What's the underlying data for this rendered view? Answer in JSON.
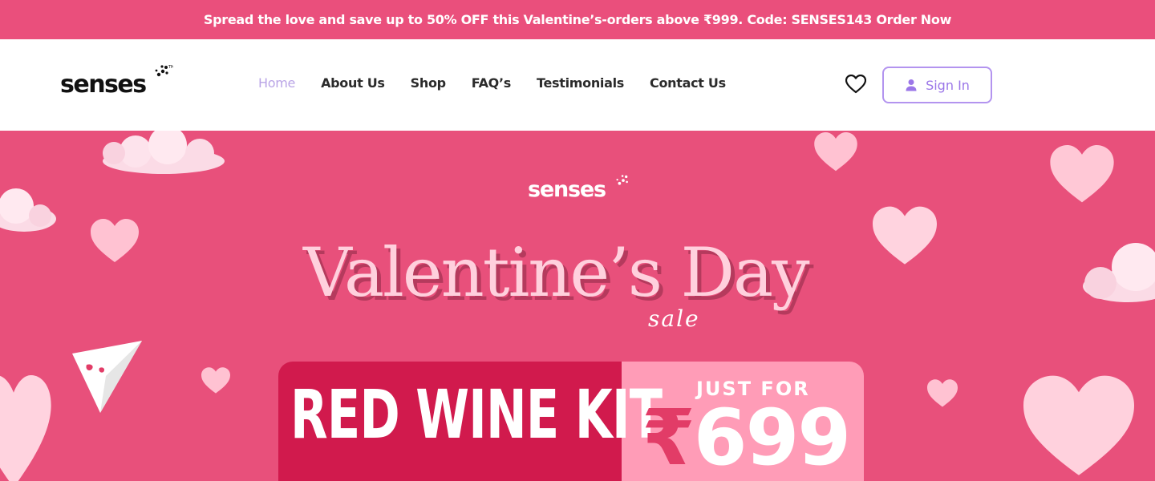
{
  "announcement": {
    "text": "Spread the love and save up to 50% OFF this Valentine’s-orders above ₹999. Code: SENSES143 Order Now"
  },
  "header": {
    "logo_text": "senses",
    "nav": [
      {
        "label": "Home",
        "active": true
      },
      {
        "label": "About Us",
        "active": false
      },
      {
        "label": "Shop",
        "active": false
      },
      {
        "label": "FAQ’s",
        "active": false
      },
      {
        "label": "Testimonials",
        "active": false
      },
      {
        "label": "Contact Us",
        "active": false
      }
    ],
    "wishlist_icon": "heart-outline-icon",
    "signin_label": "Sign In",
    "signin_icon": "user-icon"
  },
  "hero": {
    "logo_text": "senses",
    "headline": "Valentine’s Day",
    "headline_sub": "sale",
    "product": "RED WINE KIT",
    "price_label": "JUST FOR",
    "price_currency": "₹",
    "price_value": "699"
  },
  "colors": {
    "announce_bg": "#ea4f7c",
    "hero_bg": "#e8507b",
    "accent_purple": "#9b76e8",
    "offer_dark": "#d11a4d",
    "offer_light": "#ff9cb7"
  }
}
